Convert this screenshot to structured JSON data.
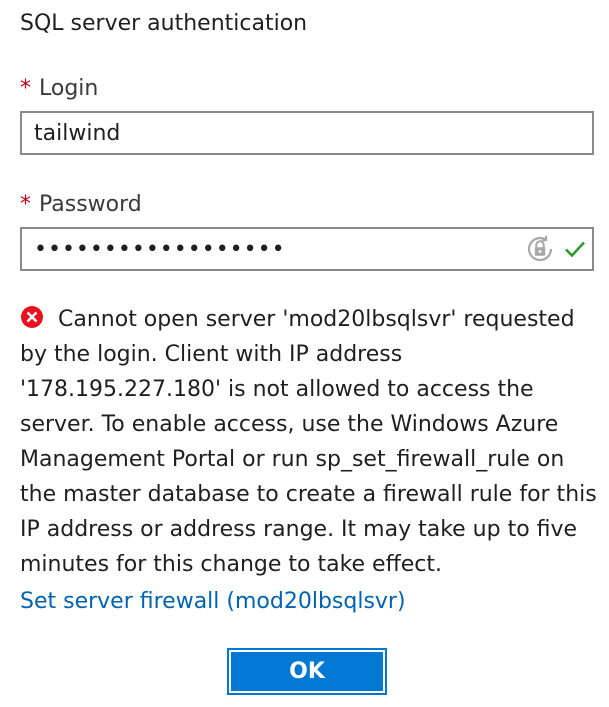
{
  "section": {
    "title": "SQL server authentication"
  },
  "login": {
    "required_mark": "*",
    "label": "Login",
    "value": "tailwind"
  },
  "password": {
    "required_mark": "*",
    "label": "Password",
    "value": "••••••••••••••••••",
    "reveal_icon": "password-reveal-icon",
    "valid_icon": "checkmark-icon",
    "valid_color": "#2e9b2e"
  },
  "error": {
    "icon": "error-icon",
    "icon_color": "#e81123",
    "message": "Cannot open server 'mod20lbsqlsvr' requested by the login. Client with IP address '178.195.227.180' is not allowed to access the server. To enable access, use the Windows Azure Management Portal or run sp_set_firewall_rule on the master database to create a firewall rule for this IP address or address range. It may take up to five minutes for this change to take effect."
  },
  "firewall_link": {
    "label": "Set server firewall (mod20lbsqlsvr)",
    "color": "#0063b1"
  },
  "actions": {
    "ok_label": "OK",
    "ok_color": "#0078d4"
  }
}
